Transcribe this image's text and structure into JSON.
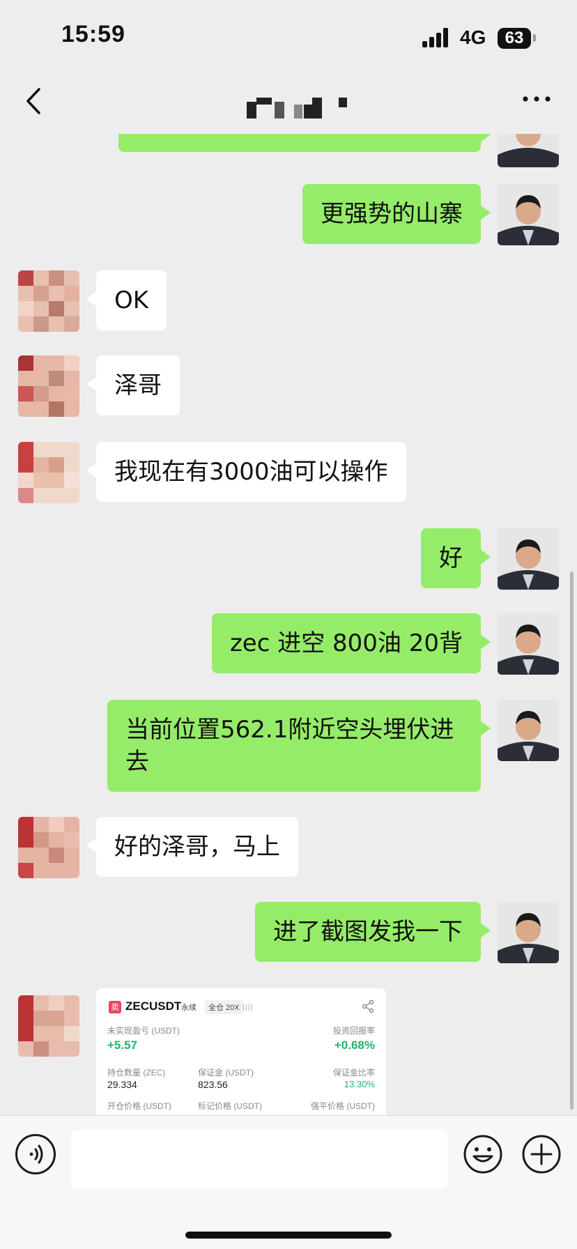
{
  "status_bar": {
    "time": "15:59",
    "network": "4G",
    "battery": "63"
  },
  "header": {
    "back_icon": "chevron-left-icon",
    "more_icon": "more-dots-icon"
  },
  "messages": [
    {
      "sender": "me",
      "text": "更强势的山寨"
    },
    {
      "sender": "other",
      "text": "OK"
    },
    {
      "sender": "other",
      "text": "泽哥"
    },
    {
      "sender": "other",
      "text": "我现在有3000油可以操作"
    },
    {
      "sender": "me",
      "text": "好"
    },
    {
      "sender": "me",
      "text": "zec 进空 800油 20背"
    },
    {
      "sender": "me",
      "text": "当前位置562.1附近空头埋伏进去"
    },
    {
      "sender": "other",
      "text": "好的泽哥，马上"
    },
    {
      "sender": "me",
      "text": "进了截图发我一下"
    }
  ],
  "trade_card": {
    "side_tag": "卖",
    "symbol": "ZECUSDT",
    "contract_type": "永续",
    "margin_mode": "全仓 20X",
    "unrealized_pnl_label": "未实现盈亏 (USDT)",
    "unrealized_pnl": "+5.57",
    "roi_label": "投资回报率",
    "roi": "+0.68%",
    "qty_label": "持仓数量 (ZEC)",
    "qty": "29.334",
    "margin_label": "保证金 (USDT)",
    "margin": "823.56",
    "margin_ratio_label": "保证金比率",
    "margin_ratio": "13.30%",
    "entry_label": "开仓价格 (USDT)",
    "mark_label": "标记价格 (USDT)",
    "liq_label": "强平价格 (USDT)"
  },
  "input_bar": {
    "placeholder": ""
  },
  "colors": {
    "my_bubble": "#95ec69",
    "other_bubble": "#ffffff",
    "background": "#ededed",
    "profit": "#20b26c"
  }
}
